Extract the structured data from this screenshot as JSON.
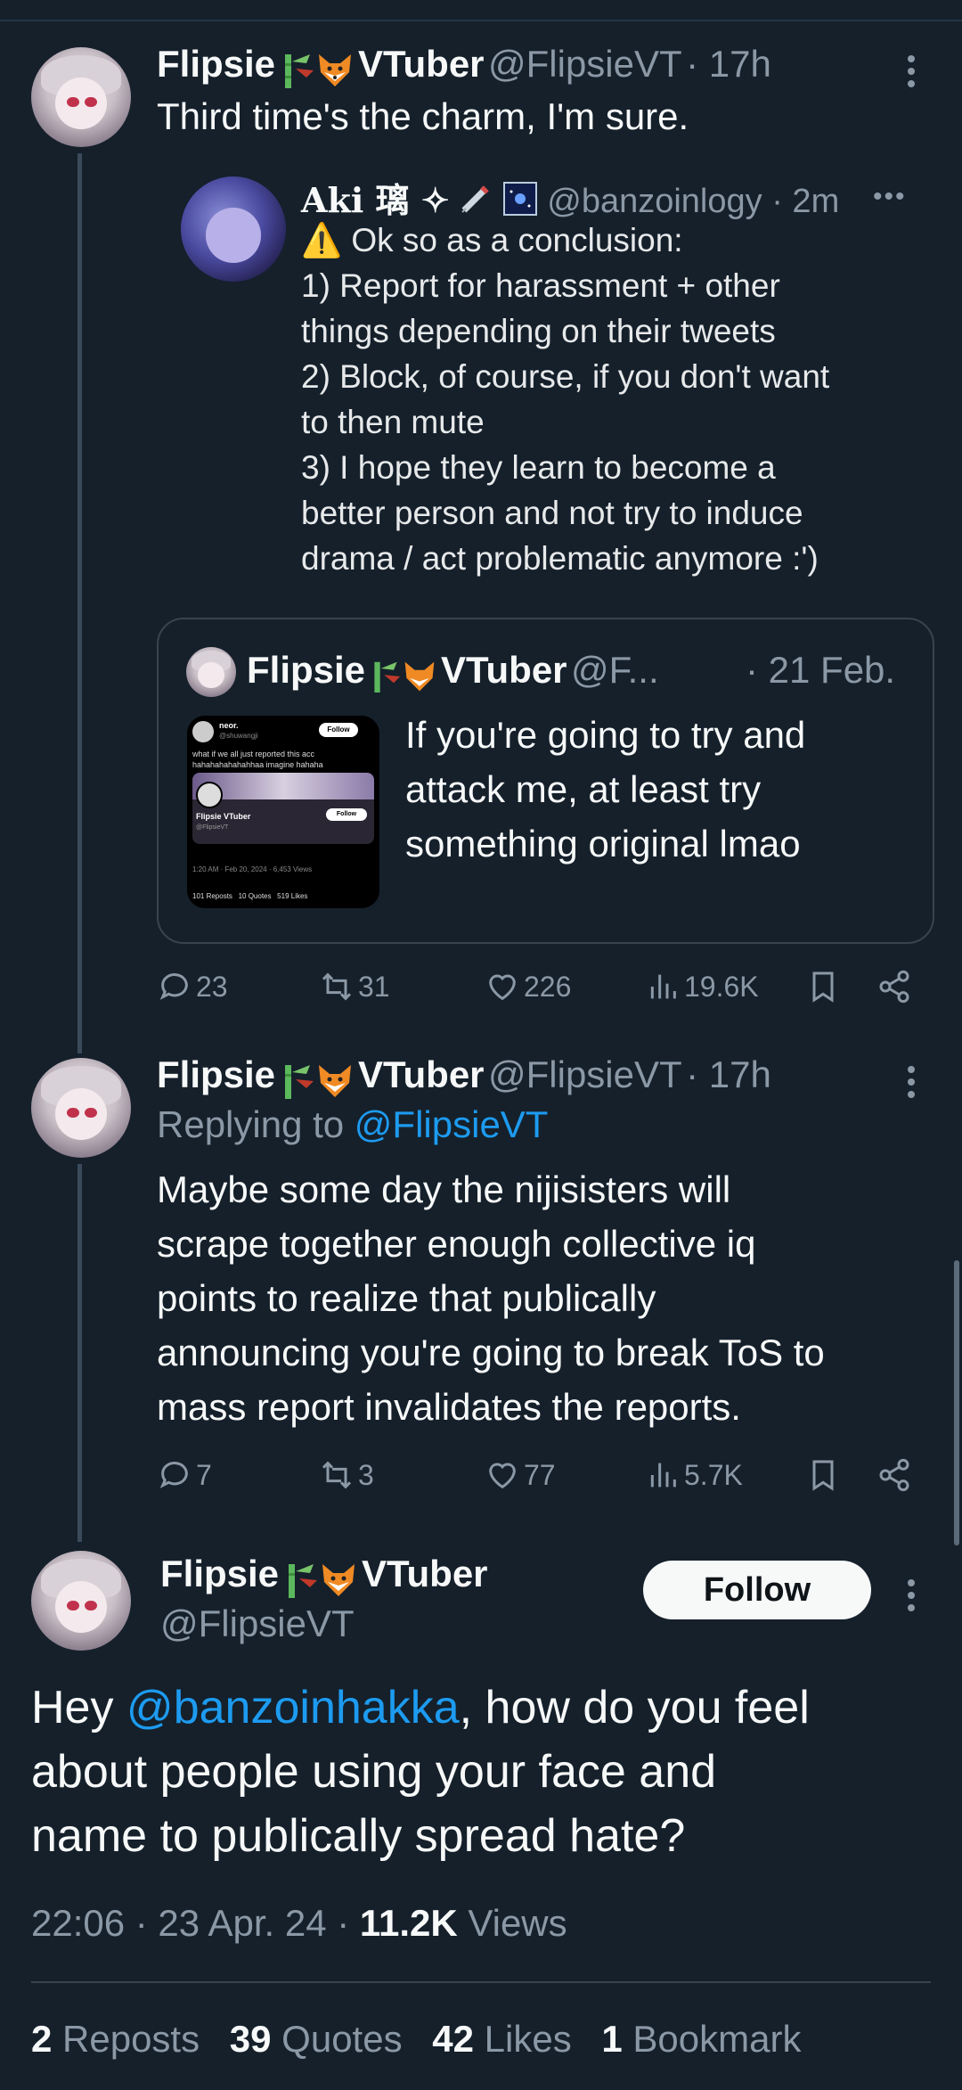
{
  "colors": {
    "background": "#15202b",
    "accent": "#1d9bf0",
    "muted": "#8b98a5",
    "border": "#38444d"
  },
  "tweet1": {
    "name": "Flipsie",
    "tag": "VTuber",
    "handle": "@FlipsieVT",
    "time": "· 17h",
    "text": "Third time's the charm, I'm sure.",
    "embedded": {
      "name": "Aki 璃 ✧",
      "handle": "@banzoinlogy",
      "time": "· 2m",
      "text": "⚠️ Ok so as a conclusion:\n1) Report for harassment + other\nthings depending on their tweets\n2) Block, of course, if you don't want\nto then mute\n3) I hope they learn to become a\nbetter person and not try to induce\ndrama / act problematic anymore :')"
    },
    "quote": {
      "name": "Flipsie",
      "tag": "VTuber",
      "handle": "@F...",
      "time": "· 21 Feb.",
      "text": "If you're going to try and\nattack me, at least try\nsomething original lmao",
      "thumb": {
        "user": "neor.",
        "user_handle": "@shuwangji",
        "follow": "Follow",
        "line1": "what if we all just reported this acc",
        "line2": "hahahahahahahhaa imagine hahaha",
        "inner_name": "Flipsie",
        "inner_tag": "VTuber",
        "inner_handle": "@FlipsieVT",
        "inner_follow": "Follow",
        "meta": "1:20 AM · Feb 20, 2024 · 6,453 Views",
        "stats": "101 Reposts   10 Quotes   519 Likes"
      }
    },
    "stats": {
      "replies": "23",
      "reposts": "31",
      "likes": "226",
      "views": "19.6K"
    }
  },
  "tweet2": {
    "name": "Flipsie",
    "tag": "VTuber",
    "handle": "@FlipsieVT",
    "time": "· 17h",
    "replying_prefix": "Replying to ",
    "replying_to": "@FlipsieVT",
    "text": "Maybe some day the nijisisters will\nscrape together enough collective iq\npoints to realize that publically\nannouncing you're going to break ToS to\nmass report invalidates the reports.",
    "stats": {
      "replies": "7",
      "reposts": "3",
      "likes": "77",
      "views": "5.7K"
    }
  },
  "main": {
    "name": "Flipsie",
    "tag": "VTuber",
    "handle": "@FlipsieVT",
    "follow_label": "Follow",
    "text_pre": "Hey ",
    "mention": "@banzoinhakka",
    "text_post": ", how do you feel\nabout people using your face and\nname to publically spread hate?",
    "time": "22:06 · 23 Apr. 24 · ",
    "views_num": "11.2K",
    "views_label": " Views",
    "reposts_num": "2",
    "reposts_label": " Reposts",
    "quotes_num": "39",
    "quotes_label": " Quotes",
    "likes_num": "42",
    "likes_label": " Likes",
    "bookmarks_num": "1",
    "bookmarks_label": " Bookmark"
  }
}
